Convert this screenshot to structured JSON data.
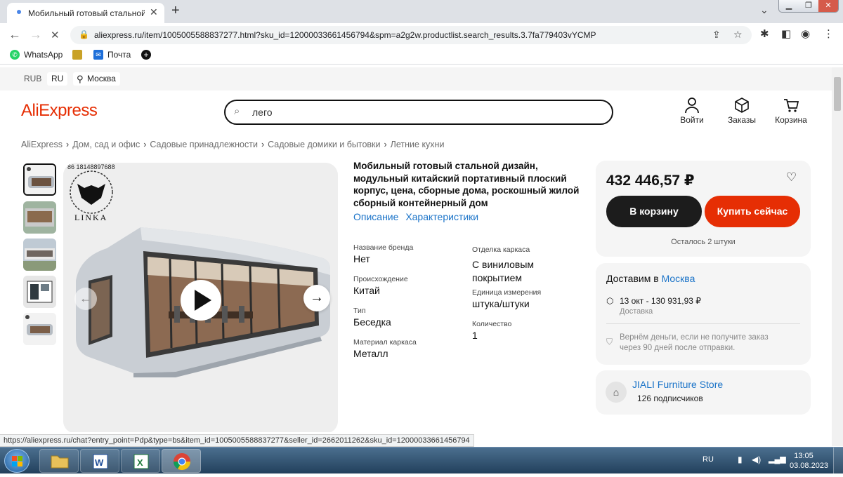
{
  "browser": {
    "tab_title": "Мобильный готовый стальной дизайн, модульный китайский портативный плоский корпус",
    "tab_close": "✕",
    "url": "aliexpress.ru/item/1005005588837277.html?sku_id=12000033661456794&spm=a2g2w.productlist.search_results.3.7fa779403vYCMP",
    "bookmarks": [
      "WhatsApp",
      "Почта"
    ],
    "status_url": "https://aliexpress.ru/chat?entry_point=Pdp&type=bs&item_id=1005005588837277&seller_id=2662011262&sku_id=12000033661456794"
  },
  "topbar": {
    "currency": "RUB",
    "lang": "RU",
    "location": "Москва"
  },
  "header": {
    "logo": "AliExpress",
    "search_value": "лего",
    "login": "Войти",
    "orders": "Заказы",
    "cart": "Корзина"
  },
  "breadcrumbs": [
    "AliExpress",
    "Дом, сад и офис",
    "Садовые принадлежности",
    "Садовые домики и бытовки",
    "Летние кухни"
  ],
  "gallery": {
    "watermark_phone": "86 18148897688",
    "brand_text": "LINKA"
  },
  "product": {
    "title": "Мобильный готовый стальной дизайн, модульный китайский портативный плоский корпус, цена, сборные дома, роскошный жилой сборный контейнерный дом",
    "tab_description": "Описание",
    "tab_specs": "Характеристики",
    "specs": [
      {
        "k": "Название бренда",
        "v": "Нет"
      },
      {
        "k": "Отделка каркаса",
        "v": "С виниловым покрытием"
      },
      {
        "k": "Происхождение",
        "v": "Китай"
      },
      {
        "k": "Единица измерения",
        "v": "штука/штуки"
      },
      {
        "k": "Тип",
        "v": "Беседка"
      },
      {
        "k": "Количество",
        "v": "1"
      },
      {
        "k": "Материал каркаса",
        "v": "Металл"
      }
    ]
  },
  "buy": {
    "price": "432 446,57 ₽",
    "add_to_cart": "В корзину",
    "buy_now": "Купить сейчас",
    "stock": "Осталось 2 штуки"
  },
  "delivery": {
    "title_prefix": "Доставим в",
    "city": "Москва",
    "date_price": "13 окт - 130 931,93 ₽",
    "method": "Доставка",
    "guarantee": "Вернём деньги, если не получите заказ через 90 дней после отправки."
  },
  "store": {
    "name": "JIALI Furniture Store",
    "subscribers": "126 подписчиков"
  },
  "taskbar": {
    "lang": "RU",
    "time": "13:05",
    "date": "03.08.2023"
  },
  "colors": {
    "brand": "#e62e04",
    "link": "#1a73c8",
    "buy_now": "#e62e04",
    "cart_btn": "#1c1c1c"
  }
}
